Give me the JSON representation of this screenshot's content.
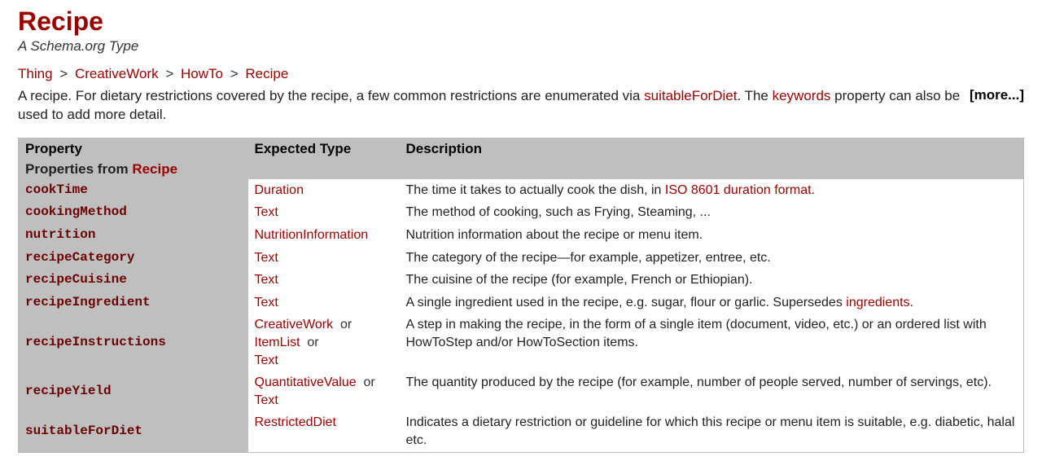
{
  "title": "Recipe",
  "subtitle": "A Schema.org Type",
  "breadcrumb": [
    {
      "label": "Thing"
    },
    {
      "label": "CreativeWork"
    },
    {
      "label": "HowTo"
    },
    {
      "label": "Recipe"
    }
  ],
  "more_label": "[more...]",
  "description": {
    "part1": "A recipe. For dietary restrictions covered by the recipe, a few common restrictions are enumerated via ",
    "link1": "suitableForDiet",
    "part2": ". The ",
    "link2": "keywords",
    "part3": " property can also be used to add more detail."
  },
  "columns": {
    "property": "Property",
    "expected_type": "Expected Type",
    "description": "Description"
  },
  "group": {
    "prefix": "Properties from ",
    "link": "Recipe"
  },
  "rows": [
    {
      "name": "cookTime",
      "types": [
        {
          "label": "Duration"
        }
      ],
      "desc_parts": [
        {
          "text": "The time it takes to actually cook the dish, in "
        },
        {
          "link": "ISO 8601 duration format"
        },
        {
          "text": "."
        }
      ]
    },
    {
      "name": "cookingMethod",
      "types": [
        {
          "label": "Text"
        }
      ],
      "desc_parts": [
        {
          "text": "The method of cooking, such as Frying, Steaming, ..."
        }
      ]
    },
    {
      "name": "nutrition",
      "types": [
        {
          "label": "NutritionInformation"
        }
      ],
      "desc_parts": [
        {
          "text": "Nutrition information about the recipe or menu item."
        }
      ]
    },
    {
      "name": "recipeCategory",
      "types": [
        {
          "label": "Text"
        }
      ],
      "desc_parts": [
        {
          "text": "The category of the recipe—for example, appetizer, entree, etc."
        }
      ]
    },
    {
      "name": "recipeCuisine",
      "types": [
        {
          "label": "Text"
        }
      ],
      "desc_parts": [
        {
          "text": "The cuisine of the recipe (for example, French or Ethiopian)."
        }
      ]
    },
    {
      "name": "recipeIngredient",
      "types": [
        {
          "label": "Text"
        }
      ],
      "desc_parts": [
        {
          "text": "A single ingredient used in the recipe, e.g. sugar, flour or garlic. Supersedes "
        },
        {
          "link": "ingredients"
        },
        {
          "text": "."
        }
      ]
    },
    {
      "name": "recipeInstructions",
      "types": [
        {
          "label": "CreativeWork"
        },
        {
          "label": "ItemList"
        },
        {
          "label": "Text"
        }
      ],
      "desc_parts": [
        {
          "text": "A step in making the recipe, in the form of a single item (document, video, etc.) or an ordered list with HowToStep and/or HowToSection items."
        }
      ]
    },
    {
      "name": "recipeYield",
      "types": [
        {
          "label": "QuantitativeValue"
        },
        {
          "label": "Text"
        }
      ],
      "desc_parts": [
        {
          "text": "The quantity produced by the recipe (for example, number of people served, number of servings, etc)."
        }
      ]
    },
    {
      "name": "suitableForDiet",
      "types": [
        {
          "label": "RestrictedDiet"
        }
      ],
      "desc_parts": [
        {
          "text": "Indicates a dietary restriction or guideline for which this recipe or menu item is suitable, e.g. diabetic, halal etc."
        }
      ]
    }
  ]
}
